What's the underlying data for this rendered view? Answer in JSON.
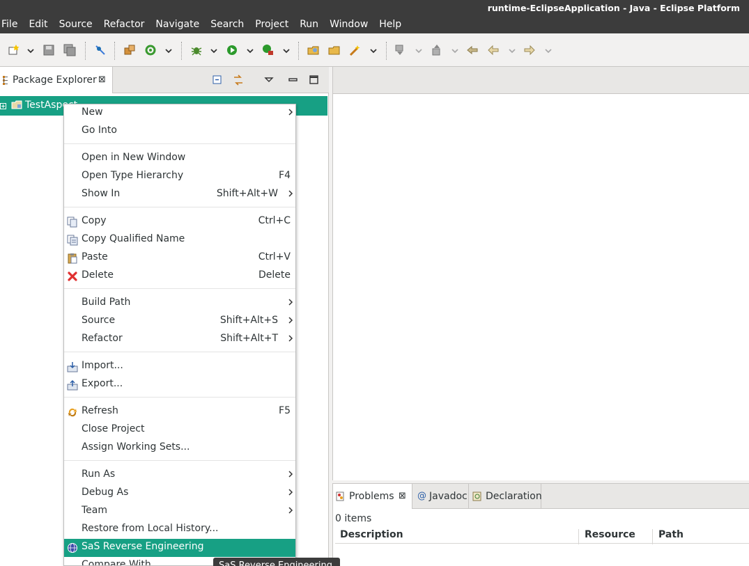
{
  "window": {
    "title": "runtime-EclipseApplication - Java - Eclipse Platform"
  },
  "menubar": {
    "items": [
      {
        "label": "File"
      },
      {
        "label": "Edit"
      },
      {
        "label": "Source"
      },
      {
        "label": "Refactor"
      },
      {
        "label": "Navigate"
      },
      {
        "label": "Search"
      },
      {
        "label": "Project"
      },
      {
        "label": "Run"
      },
      {
        "label": "Window"
      },
      {
        "label": "Help"
      }
    ]
  },
  "toolbar": {
    "icons": [
      "new-wizard-icon",
      "save-icon",
      "save-all-icon",
      "toggle-breakpoint-icon",
      "open-type-icon",
      "refresh-build-icon",
      "debug-icon",
      "run-icon",
      "external-tools-icon",
      "open-folder-icon",
      "open-file-icon",
      "wand-icon",
      "next-annotation-icon",
      "previous-annotation-icon",
      "last-edit-icon",
      "back-icon",
      "forward-icon"
    ]
  },
  "package_explorer": {
    "tab_label": "Package Explorer",
    "project_label": "TestAspect",
    "colors": {
      "selection": "#17a084"
    }
  },
  "context_menu": {
    "groups": [
      [
        {
          "label": "New",
          "shortcut": "",
          "submenu": true,
          "icon": ""
        },
        {
          "label": "Go Into",
          "shortcut": "",
          "submenu": false,
          "icon": ""
        }
      ],
      [
        {
          "label": "Open in New Window",
          "shortcut": "",
          "submenu": false,
          "icon": ""
        },
        {
          "label": "Open Type Hierarchy",
          "shortcut": "F4",
          "submenu": false,
          "icon": ""
        },
        {
          "label": "Show In",
          "shortcut": "Shift+Alt+W",
          "submenu": true,
          "icon": ""
        }
      ],
      [
        {
          "label": "Copy",
          "shortcut": "Ctrl+C",
          "submenu": false,
          "icon": "copy-icon"
        },
        {
          "label": "Copy Qualified Name",
          "shortcut": "",
          "submenu": false,
          "icon": "copy-qualified-name-icon"
        },
        {
          "label": "Paste",
          "shortcut": "Ctrl+V",
          "submenu": false,
          "icon": "paste-icon"
        },
        {
          "label": "Delete",
          "shortcut": "Delete",
          "submenu": false,
          "icon": "delete-icon"
        }
      ],
      [
        {
          "label": "Build Path",
          "shortcut": "",
          "submenu": true,
          "icon": ""
        },
        {
          "label": "Source",
          "shortcut": "Shift+Alt+S",
          "submenu": true,
          "icon": ""
        },
        {
          "label": "Refactor",
          "shortcut": "Shift+Alt+T",
          "submenu": true,
          "icon": ""
        }
      ],
      [
        {
          "label": "Import...",
          "shortcut": "",
          "submenu": false,
          "icon": "import-icon"
        },
        {
          "label": "Export...",
          "shortcut": "",
          "submenu": false,
          "icon": "export-icon"
        }
      ],
      [
        {
          "label": "Refresh",
          "shortcut": "F5",
          "submenu": false,
          "icon": "refresh-icon"
        },
        {
          "label": "Close Project",
          "shortcut": "",
          "submenu": false,
          "icon": ""
        },
        {
          "label": "Assign Working Sets...",
          "shortcut": "",
          "submenu": false,
          "icon": ""
        }
      ],
      [
        {
          "label": "Run As",
          "shortcut": "",
          "submenu": true,
          "icon": ""
        },
        {
          "label": "Debug As",
          "shortcut": "",
          "submenu": true,
          "icon": ""
        },
        {
          "label": "Team",
          "shortcut": "",
          "submenu": true,
          "icon": ""
        },
        {
          "label": "Restore from Local History...",
          "shortcut": "",
          "submenu": false,
          "icon": ""
        },
        {
          "label": "SaS Reverse Engineering",
          "shortcut": "",
          "submenu": false,
          "icon": "globe-icon",
          "highlighted": true
        },
        {
          "label": "Compare With",
          "shortcut": "",
          "submenu": true,
          "icon": ""
        }
      ]
    ],
    "colors": {
      "highlight": "#17a084"
    }
  },
  "tooltip": {
    "text": "SaS Reverse Engineering"
  },
  "bottom_panel": {
    "tabs": [
      {
        "label": "Problems",
        "active": true,
        "icon": "problems-icon"
      },
      {
        "label": "Javadoc",
        "active": false,
        "icon": "javadoc-icon"
      },
      {
        "label": "Declaration",
        "active": false,
        "icon": "declaration-icon"
      }
    ],
    "status": "0 items",
    "columns": [
      "Description",
      "Resource",
      "Path"
    ]
  }
}
